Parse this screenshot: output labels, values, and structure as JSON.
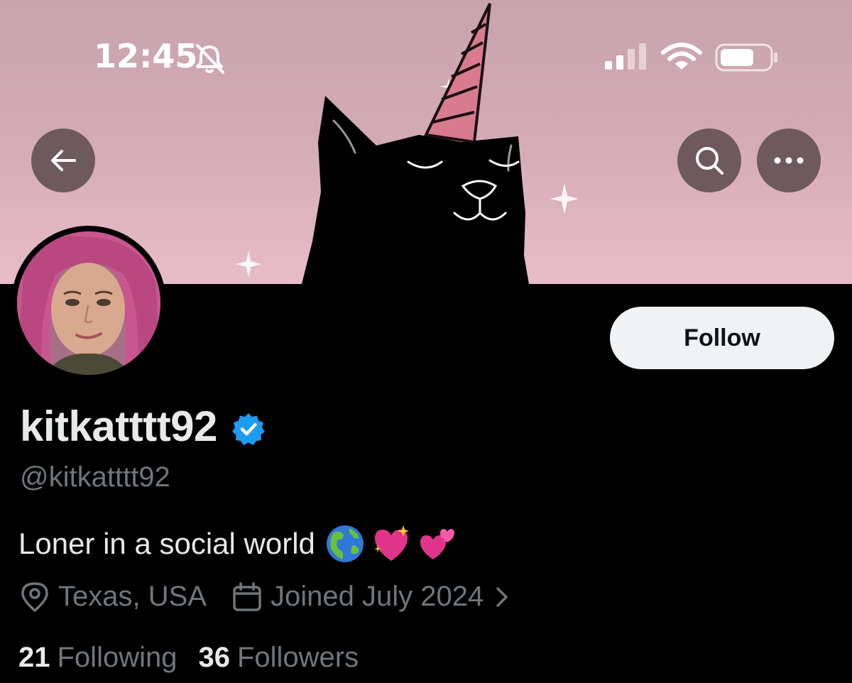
{
  "status_bar": {
    "time": "12:45"
  },
  "profile": {
    "display_name": "kitkatttt92",
    "handle": "@kitkatttt92",
    "bio": "Loner in a social world",
    "location": "Texas, USA",
    "joined": "Joined July 2024",
    "following_count": "21",
    "following_label": "Following",
    "followers_count": "36",
    "followers_label": "Followers"
  },
  "actions": {
    "follow_label": "Follow"
  },
  "icons": {
    "back": "arrow-left-icon",
    "search": "search-icon",
    "more": "more-icon",
    "location": "location-pin-icon",
    "calendar": "calendar-icon",
    "verified": "verified-badge-icon"
  },
  "colors": {
    "background": "#000000",
    "banner_pink": "#e8bcc8",
    "verified_blue": "#1d9bf0",
    "follow_button_bg": "#eff3f4",
    "secondary_text": "#71767b"
  }
}
